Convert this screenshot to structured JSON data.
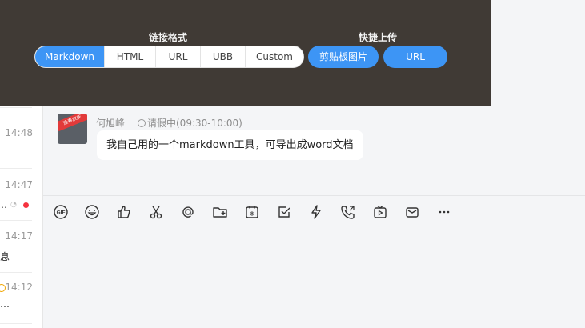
{
  "overlay": {
    "link_format_title": "链接格式",
    "format_options": [
      {
        "label": "Markdown",
        "active": true
      },
      {
        "label": "HTML",
        "active": false
      },
      {
        "label": "URL",
        "active": false
      },
      {
        "label": "UBB",
        "active": false
      },
      {
        "label": "Custom",
        "active": false
      }
    ],
    "quick_upload_title": "快捷上传",
    "quick_upload_buttons": [
      {
        "label": "剪贴板图片"
      },
      {
        "label": "URL"
      }
    ]
  },
  "sidebar": {
    "times": [
      "14:48",
      "14:47",
      "14:17",
      "14:12"
    ],
    "previews": [
      "…",
      "息",
      "…"
    ]
  },
  "message": {
    "sender": "何旭峰",
    "status": "请假中(09:30-10:00)",
    "text": "我自己用的一个markdown工具，可导出成word文档",
    "avatar_badge": "逢春欢庆"
  },
  "toolbar": {
    "icons": [
      "gif-icon",
      "emoji-icon",
      "thumbs-up-icon",
      "scissors-icon",
      "at-icon",
      "folder-add-icon",
      "calendar-icon",
      "checkbox-icon",
      "lightning-icon",
      "phone-icon",
      "video-icon",
      "mail-icon",
      "more-icon"
    ]
  },
  "colors": {
    "accent": "#3d95f5",
    "overlay_bg": "#403a35",
    "chat_bg": "#f4f5f7",
    "unread_dot": "#f5333f"
  }
}
